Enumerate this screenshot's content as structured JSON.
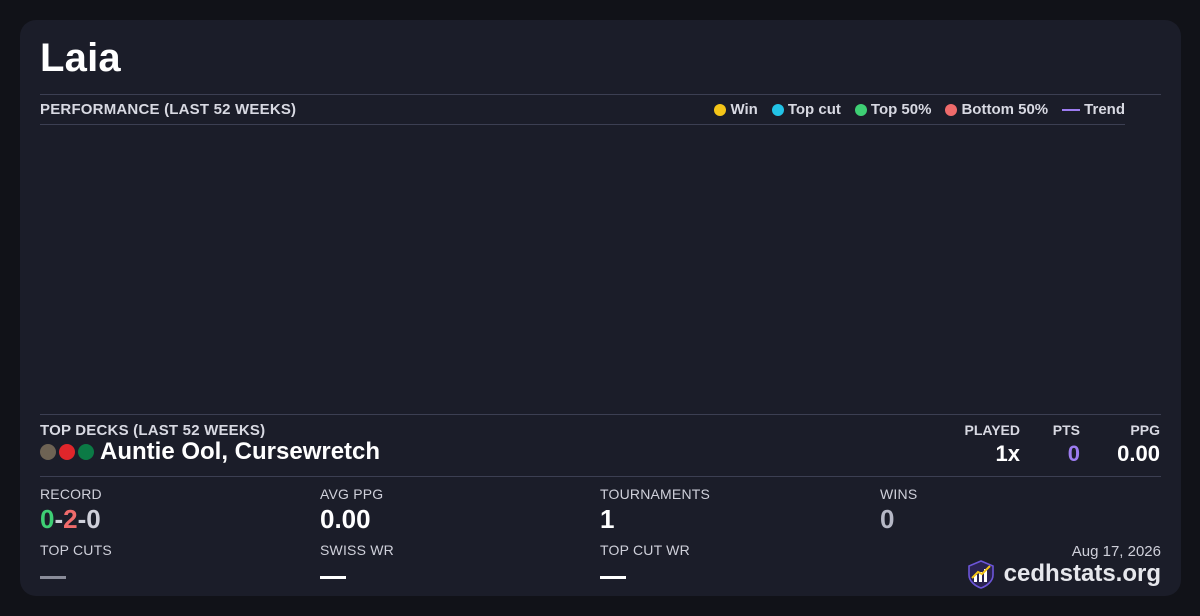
{
  "player": {
    "name": "Laia"
  },
  "performance": {
    "title": "PERFORMANCE (LAST 52 WEEKS)",
    "legend": [
      {
        "label": "Win",
        "color": "#f5c518",
        "shape": "dot"
      },
      {
        "label": "Top cut",
        "color": "#22c3e6",
        "shape": "dot"
      },
      {
        "label": "Top 50%",
        "color": "#3ecf74",
        "shape": "dot"
      },
      {
        "label": "Bottom 50%",
        "color": "#ef6b6b",
        "shape": "dot"
      },
      {
        "label": "Trend",
        "color": "#9d7cf0",
        "shape": "line"
      }
    ]
  },
  "top_decks": {
    "title": "TOP DECKS (LAST 52 WEEKS)",
    "columns": {
      "played": "PLAYED",
      "pts": "PTS",
      "ppg": "PPG"
    },
    "deck": {
      "name": "Auntie Ool, Cursewretch",
      "colors": [
        "#6e6354",
        "#e0262b",
        "#0b7a45"
      ],
      "played": "1x",
      "pts": "0",
      "ppg": "0.00"
    }
  },
  "stats": {
    "record": {
      "label": "RECORD",
      "wins": "0",
      "losses": "2",
      "draws": "0",
      "sep": "-",
      "win_color": "#3ecf74",
      "loss_color": "#ef6b6b",
      "draw_color": "#cfd0da"
    },
    "avg_ppg": {
      "label": "AVG PPG",
      "value": "0.00"
    },
    "tournaments": {
      "label": "TOURNAMENTS",
      "value": "1"
    },
    "wins": {
      "label": "WINS",
      "value": "0"
    },
    "top_cuts": {
      "label": "TOP CUTS"
    },
    "swiss_wr": {
      "label": "SWISS WR"
    },
    "top_cut_wr": {
      "label": "TOP CUT WR"
    }
  },
  "footer": {
    "date": "Aug 17, 2026",
    "brand": "cedhstats.org",
    "logo_icon": "bar-chart-shield-icon"
  }
}
